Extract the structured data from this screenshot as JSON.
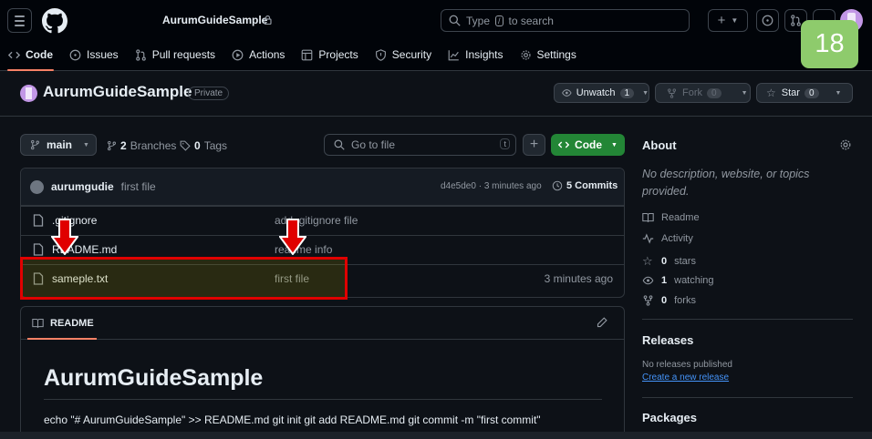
{
  "topbar": {
    "repo_name": "AurumGuideSample",
    "search_placeholder_before": "Type",
    "search_key": "/",
    "search_placeholder_after": "to search"
  },
  "tabs": [
    {
      "label": "Code",
      "icon": "code-icon"
    },
    {
      "label": "Issues",
      "icon": "issue-icon"
    },
    {
      "label": "Pull requests",
      "icon": "pull-request-icon"
    },
    {
      "label": "Actions",
      "icon": "play-icon"
    },
    {
      "label": "Projects",
      "icon": "table-icon"
    },
    {
      "label": "Security",
      "icon": "shield-icon"
    },
    {
      "label": "Insights",
      "icon": "graph-icon"
    },
    {
      "label": "Settings",
      "icon": "gear-icon"
    }
  ],
  "step_badge": "18",
  "repo": {
    "title": "AurumGuideSample",
    "visibility": "Private",
    "unwatch_label": "Unwatch",
    "unwatch_count": "1",
    "fork_label": "Fork",
    "fork_count": "0",
    "star_label": "Star",
    "star_count": "0"
  },
  "toolbar": {
    "branch": "main",
    "branches_count": "2",
    "branches_label": "Branches",
    "tags_count": "0",
    "tags_label": "Tags",
    "goto_placeholder": "Go to file",
    "goto_key": "t",
    "add_label": "+",
    "code_label": "Code"
  },
  "commit": {
    "user": "aurumgudie",
    "message": "first file",
    "hash_time": "d4e5de0 · 3 minutes ago",
    "commits_label": "5 Commits"
  },
  "files": [
    {
      "name": ".gitignore",
      "message": "add .gitignore file",
      "time": ""
    },
    {
      "name": "README.md",
      "message": "readme info",
      "time": ""
    },
    {
      "name": "sameple.txt",
      "message": "first file",
      "time": "3 minutes ago"
    }
  ],
  "readme": {
    "tab_label": "README",
    "heading": "AurumGuideSample",
    "body": "echo \"# AurumGuideSample\" >> README.md git init git add README.md git commit -m \"first commit\""
  },
  "about": {
    "title": "About",
    "description": "No description, website, or topics provided.",
    "readme": "Readme",
    "activity": "Activity",
    "stars_count": "0",
    "stars_label": "stars",
    "watching_count": "1",
    "watching_label": "watching",
    "forks_count": "0",
    "forks_label": "forks"
  },
  "releases": {
    "title": "Releases",
    "none": "No releases published",
    "create_link": "Create a new release"
  },
  "packages": {
    "title": "Packages"
  },
  "colors": {
    "accent_green": "#238636",
    "highlight_red": "#e00000",
    "badge_green": "#8ecb6c"
  }
}
